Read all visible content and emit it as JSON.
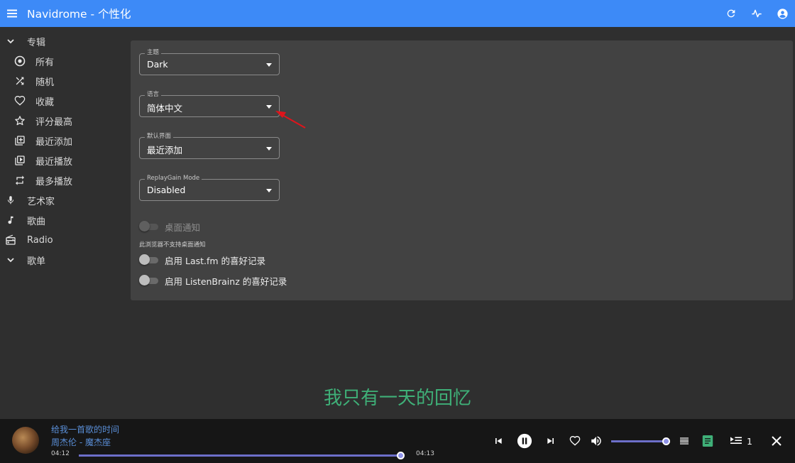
{
  "app": {
    "title": "Navidrome - 个性化"
  },
  "sidebar": {
    "items": [
      {
        "label": "专辑",
        "icon": "chevron-down-icon",
        "level": "top"
      },
      {
        "label": "所有",
        "icon": "album-disc-icon",
        "level": "sub"
      },
      {
        "label": "随机",
        "icon": "shuffle-icon",
        "level": "sub"
      },
      {
        "label": "收藏",
        "icon": "heart-icon",
        "level": "sub"
      },
      {
        "label": "评分最高",
        "icon": "star-icon",
        "level": "sub"
      },
      {
        "label": "最近添加",
        "icon": "library-add-icon",
        "level": "sub"
      },
      {
        "label": "最近播放",
        "icon": "video-library-icon",
        "level": "sub"
      },
      {
        "label": "最多播放",
        "icon": "repeat-icon",
        "level": "sub"
      },
      {
        "label": "艺术家",
        "icon": "microphone-icon",
        "level": "top"
      },
      {
        "label": "歌曲",
        "icon": "music-note-icon",
        "level": "top"
      },
      {
        "label": "Radio",
        "icon": "radio-icon",
        "level": "top"
      },
      {
        "label": "歌单",
        "icon": "chevron-down-icon",
        "level": "top"
      }
    ]
  },
  "settings": {
    "theme": {
      "label": "主题",
      "value": "Dark"
    },
    "language": {
      "label": "语言",
      "value": "简体中文"
    },
    "default_view": {
      "label": "默认界面",
      "value": "最近添加"
    },
    "replaygain": {
      "label": "ReplayGain Mode",
      "value": "Disabled"
    },
    "desktop_notify": {
      "label": "桌面通知",
      "enabled": false,
      "disabled": true
    },
    "desktop_notify_helper": "此浏览器不支持桌面通知",
    "lastfm": {
      "label": "启用 Last.fm 的喜好记录",
      "enabled": false
    },
    "listenbrainz": {
      "label": "启用 ListenBrainz 的喜好记录",
      "enabled": false
    }
  },
  "lyric": "我只有一天的回忆",
  "player": {
    "song_title": "给我一首歌的时间",
    "artist_album": "周杰伦 - 魔杰座",
    "current_time": "04:12",
    "total_time": "04:13",
    "progress_fraction": 0.99,
    "volume_fraction": 0.99,
    "queue_count": "1"
  },
  "colors": {
    "appbar": "#3d8af7",
    "background": "#2f2f2f",
    "panel": "#424242",
    "lyric": "#3fb078",
    "accent": "#6c6fc9",
    "annotation_arrow": "#e0141b"
  }
}
